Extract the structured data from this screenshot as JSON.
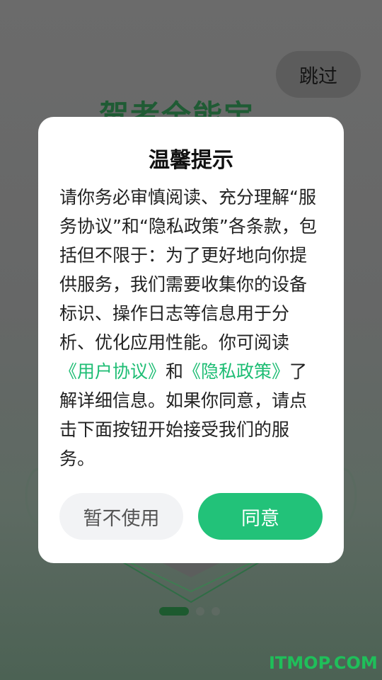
{
  "background": {
    "app_title": "贺者全能宝",
    "skip_label": "跳过",
    "watermark": "ITMOP.COM"
  },
  "dialog": {
    "title": "温馨提示",
    "body_part1": "请你务必审慎阅读、充分理解“服务协议”和“隐私政策”各条款，包括但不限于：为了更好地向你提供服务，我们需要收集你的设备标识、操作日志等信息用于分析、优化应用性能。你可阅读",
    "user_agreement_link": "《用户协议》",
    "body_and": "和",
    "privacy_policy_link": "《隐私政策》",
    "body_part2": "了解详细信息。如果你同意，请点击下面按钮开始接受我们的服务。",
    "decline_label": "暂不使用",
    "agree_label": "同意"
  },
  "pager": {
    "total": 3,
    "active_index": 0
  },
  "colors": {
    "accent": "#22c279",
    "link": "#1ebd74",
    "dialog_bg": "#ffffff",
    "overlay": "#666767"
  }
}
